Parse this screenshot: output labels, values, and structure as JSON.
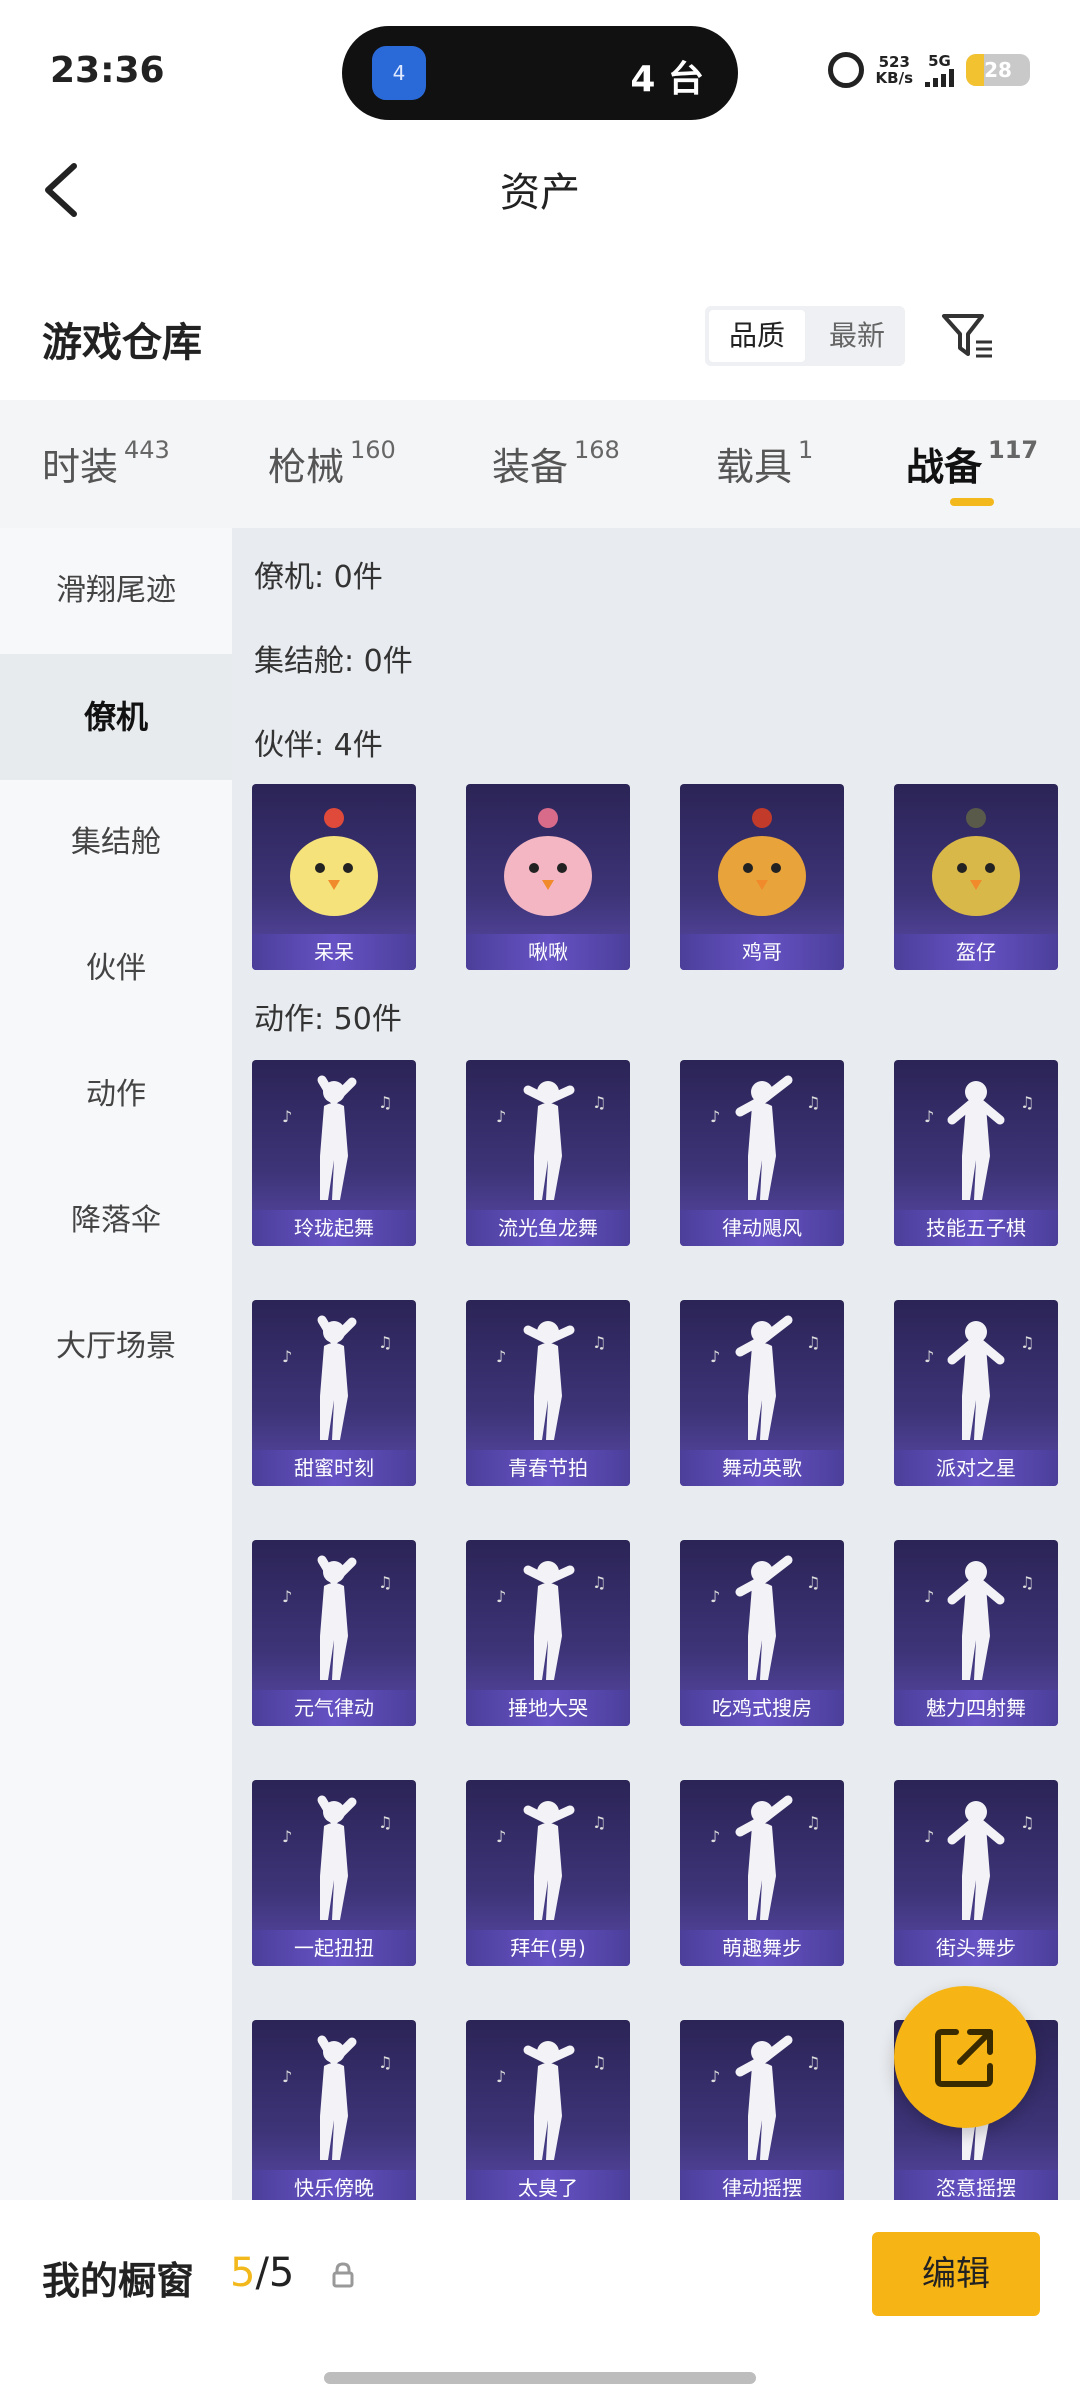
{
  "status_bar": {
    "time": "23:36",
    "island_badge": "4",
    "island_text": "4 台",
    "net_speed_value": "523",
    "net_speed_unit": "KB/s",
    "network": "5G",
    "battery": "28"
  },
  "header": {
    "title": "资产"
  },
  "section": {
    "title": "游戏仓库",
    "sort_options": [
      "品质",
      "最新"
    ]
  },
  "tabs": [
    {
      "label": "时装",
      "count": "443"
    },
    {
      "label": "枪械",
      "count": "160"
    },
    {
      "label": "装备",
      "count": "168"
    },
    {
      "label": "载具",
      "count": "1"
    },
    {
      "label": "战备",
      "count": "117"
    }
  ],
  "sidebar": [
    "滑翔尾迹",
    "僚机",
    "集结舱",
    "伙伴",
    "动作",
    "降落伞",
    "大厅场景"
  ],
  "groups": {
    "wingman": "僚机: 0件",
    "capsule": "集结舱: 0件",
    "partner": "伙伴: 4件",
    "emote": "动作: 50件"
  },
  "partners": [
    "呆呆",
    "啾啾",
    "鸡哥",
    "盔仔"
  ],
  "emotes": [
    "玲珑起舞",
    "流光鱼龙舞",
    "律动飓风",
    "技能五子棋",
    "甜蜜时刻",
    "青春节拍",
    "舞动英歌",
    "派对之星",
    "元气律动",
    "捶地大哭",
    "吃鸡式搜房",
    "魅力四射舞",
    "一起扭扭",
    "拜年(男)",
    "萌趣舞步",
    "街头舞步",
    "快乐傍晚",
    "太臭了",
    "律动摇摆",
    "恣意摇摆"
  ],
  "bottom": {
    "showcase_label": "我的橱窗",
    "showcase_current": "5",
    "showcase_total": "/5",
    "edit_label": "编辑"
  },
  "colors": {
    "accent": "#f6b515",
    "card_bg": "#3d3478"
  }
}
